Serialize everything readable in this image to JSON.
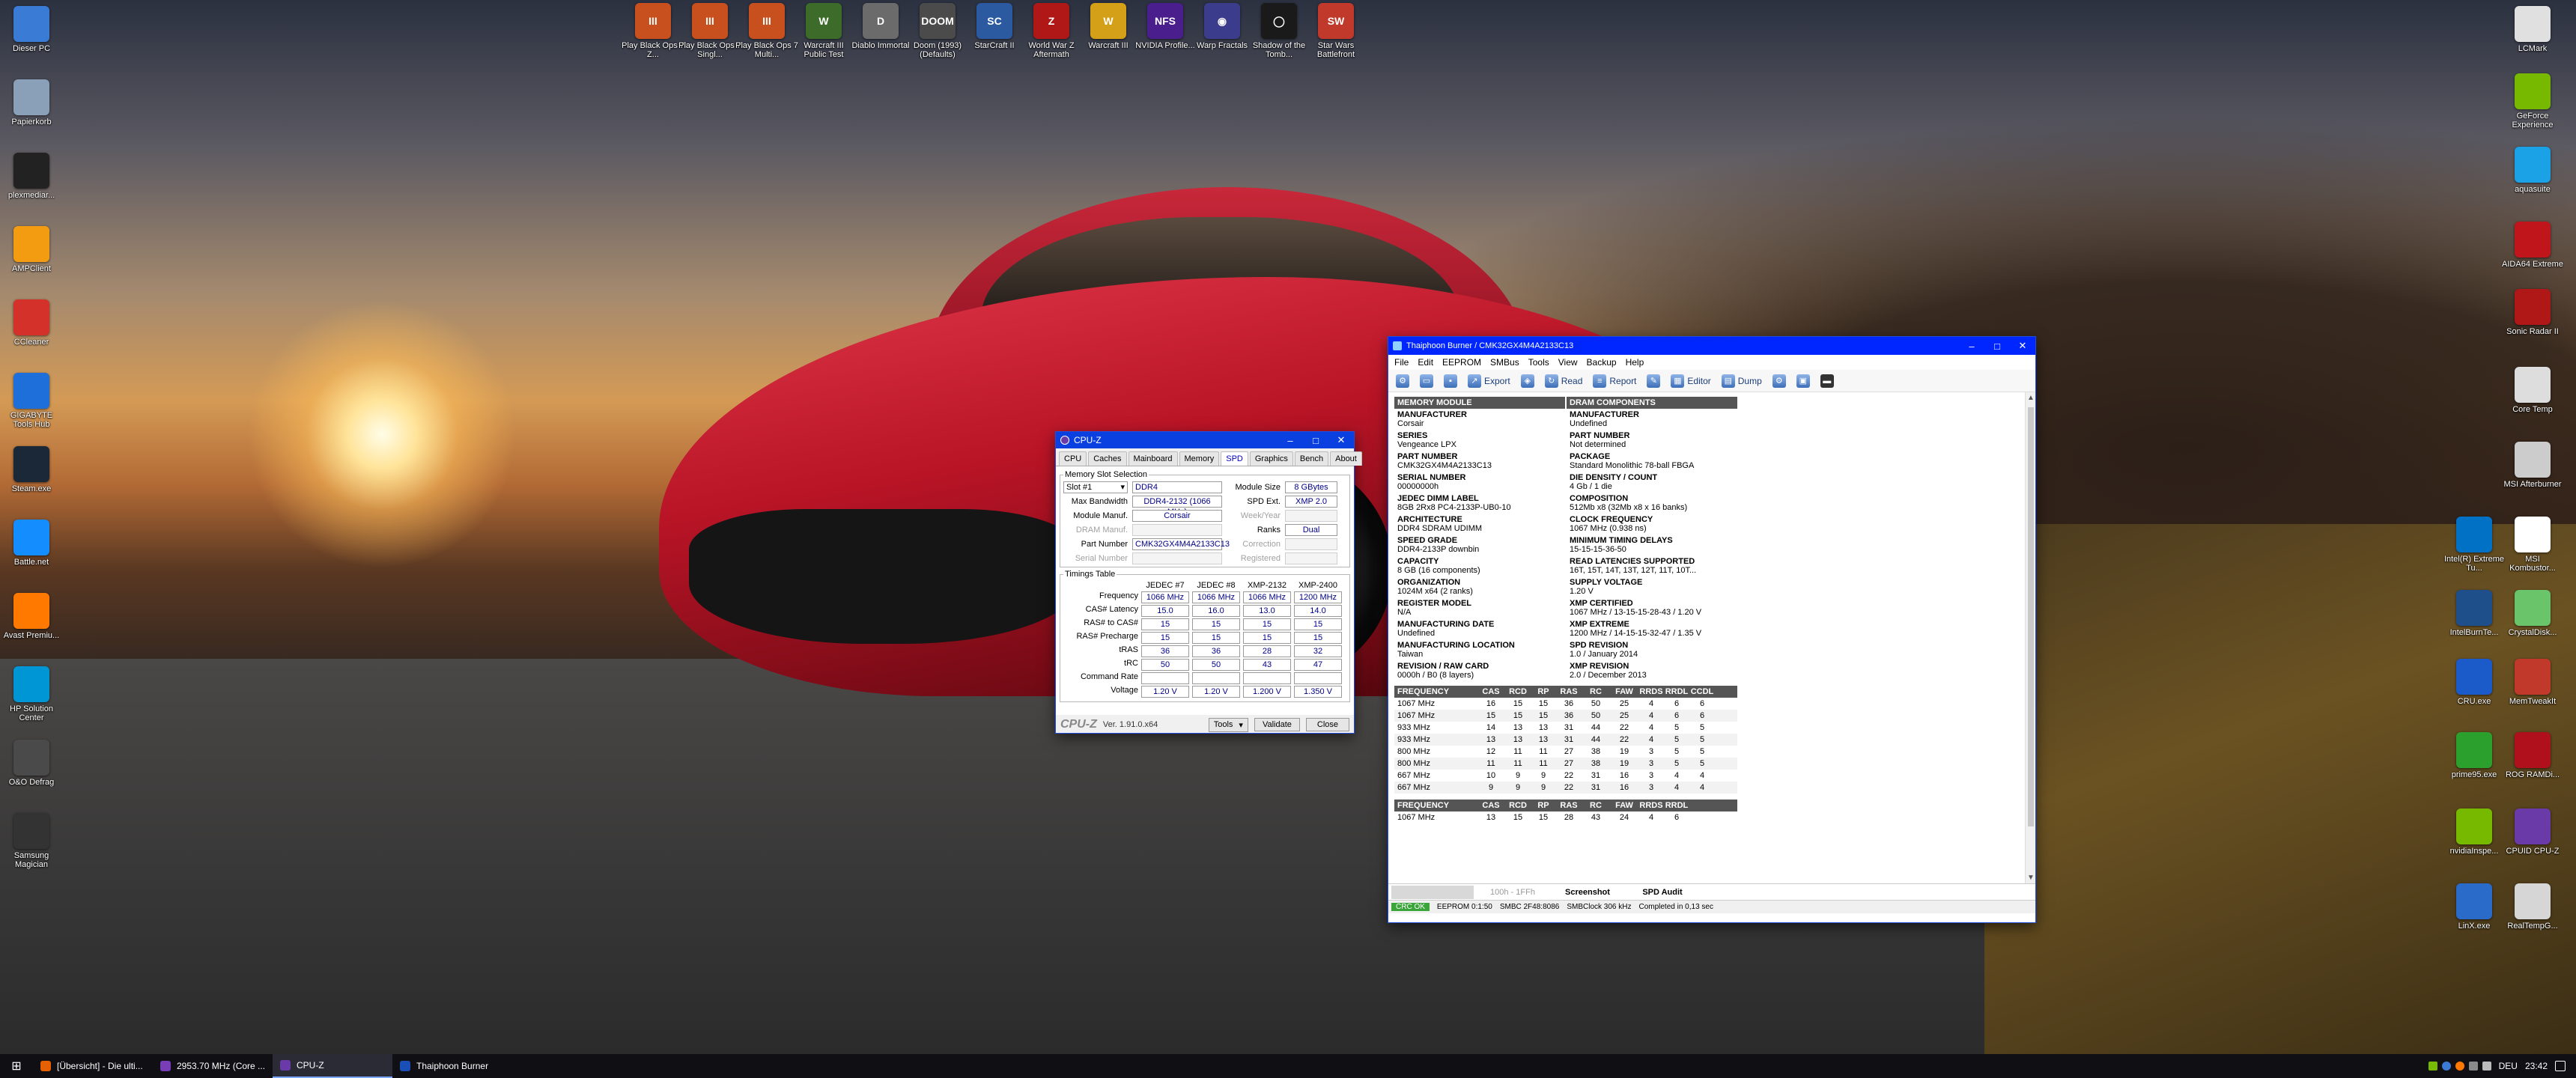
{
  "desktop": {
    "left_icons": [
      {
        "label": "Dieser PC",
        "icon": "pc-icon",
        "color": "#3a7bd5"
      },
      {
        "label": "Papierkorb",
        "icon": "recycle-bin-icon",
        "color": "#8aa0b8"
      },
      {
        "label": "plexmediar...",
        "icon": "penguin-icon",
        "color": "#222222"
      },
      {
        "label": "AMPClient",
        "icon": "amp-icon",
        "color": "#f39c12"
      },
      {
        "label": "CCleaner",
        "icon": "ccleaner-icon",
        "color": "#d4312b"
      },
      {
        "label": "GIGABYTE Tools Hub",
        "icon": "lightning-icon",
        "color": "#1e6fd9"
      },
      {
        "label": "Steam.exe",
        "icon": "steam-icon",
        "color": "#1b2838"
      },
      {
        "label": "Battle.net",
        "icon": "battlenet-icon",
        "color": "#148eff"
      },
      {
        "label": "Avast Premiu...",
        "icon": "avast-icon",
        "color": "#ff7800"
      },
      {
        "label": "HP Solution Center",
        "icon": "hp-icon",
        "color": "#0096d6"
      },
      {
        "label": "O&O Defrag",
        "icon": "defrag-icon",
        "color": "#4a4a4a"
      },
      {
        "label": "Samsung Magician",
        "icon": "samsung-icon",
        "color": "#333333"
      }
    ],
    "top_icons": [
      {
        "label": "Play Black Ops 7 Z...",
        "text": "III",
        "color": "#c8501e"
      },
      {
        "label": "Play Black Ops 7 Singl...",
        "text": "III",
        "color": "#c8501e"
      },
      {
        "label": "Play Black Ops 7 Multi...",
        "text": "III",
        "color": "#c8501e"
      },
      {
        "label": "Warcraft III Public Test",
        "text": "W",
        "color": "#3c6b2a"
      },
      {
        "label": "Diablo Immortal",
        "text": "D",
        "color": "#6b6b6b"
      },
      {
        "label": "Doom (1993) (Defaults)",
        "text": "DOOM",
        "color": "#4b4b4b"
      },
      {
        "label": "StarCraft II",
        "text": "SC",
        "color": "#2c5aa0"
      },
      {
        "label": "World War Z Aftermath",
        "text": "Z",
        "color": "#b01818"
      },
      {
        "label": "Warcraft III",
        "text": "W",
        "color": "#d4a017"
      },
      {
        "label": "NVIDIA Profile...",
        "text": "NFS",
        "color": "#4a1e8c"
      },
      {
        "label": "Warp Fractals",
        "text": "◉",
        "color": "#3c3c8c"
      },
      {
        "label": "Shadow of the Tomb...",
        "text": "◯",
        "color": "#1a1a1a"
      },
      {
        "label": "Star Wars Battlefront",
        "text": "SW",
        "color": "#c0392b"
      }
    ],
    "right_icons": [
      {
        "label": "LCMark",
        "icon": "document-icon",
        "color": "#e0e0e0"
      },
      {
        "label": "GeForce Experience",
        "icon": "nvidia-icon",
        "color": "#76b900"
      },
      {
        "label": "aquasuite",
        "icon": "aquasuite-icon",
        "color": "#1aa1e6"
      },
      {
        "label": "AIDA64 Extreme",
        "icon": "aida64-icon",
        "color": "#c0151a"
      },
      {
        "label": "Sonic Radar II",
        "icon": "radar-icon",
        "color": "#b01818"
      },
      {
        "label": "Core Temp",
        "icon": "thermometer-icon",
        "color": "#dddddd"
      },
      {
        "label": "MSI Afterburner",
        "icon": "afterburner-icon",
        "color": "#cccccc"
      },
      {
        "label": "Intel(R) Extreme Tu...",
        "icon": "intel-icon",
        "color": "#0071c5"
      },
      {
        "label": "MSI Kombustor...",
        "icon": "kombustor-icon",
        "color": "#ffffff"
      },
      {
        "label": "IntelBurnTe...",
        "icon": "burn-icon",
        "color": "#1e4f8a"
      },
      {
        "label": "CrystalDisk...",
        "icon": "crystaldisk-icon",
        "color": "#6ac46a"
      },
      {
        "label": "CRU.exe",
        "icon": "cru-icon",
        "color": "#1a5bc9"
      },
      {
        "label": "MemTweakIt",
        "icon": "memtweak-icon",
        "color": "#c0392b"
      },
      {
        "label": "prime95.exe",
        "icon": "prime95-icon",
        "color": "#2ca02c"
      },
      {
        "label": "ROG RAMDi...",
        "icon": "rog-icon",
        "color": "#b0101c"
      },
      {
        "label": "nvidiaInspe...",
        "icon": "nvidia-inspector-icon",
        "color": "#76b900"
      },
      {
        "label": "CPUID CPU-Z",
        "icon": "cpuz-icon",
        "color": "#6a3aa8"
      },
      {
        "label": "LinX.exe",
        "icon": "linx-icon",
        "color": "#2a6ac8"
      },
      {
        "label": "RealTempG...",
        "icon": "realtemp-icon",
        "color": "#d6d6d6"
      }
    ]
  },
  "cpuz": {
    "title": "CPU-Z",
    "tabs": [
      "CPU",
      "Caches",
      "Mainboard",
      "Memory",
      "SPD",
      "Graphics",
      "Bench",
      "About"
    ],
    "active_tab": "SPD",
    "slot_section": "Memory Slot Selection",
    "slot": "Slot #1",
    "type": "DDR4",
    "labels": {
      "max_bw": "Max Bandwidth",
      "module_manuf": "Module Manuf.",
      "dram_manuf": "DRAM Manuf.",
      "part_number": "Part Number",
      "serial_number": "Serial Number",
      "module_size": "Module Size",
      "spd_ext": "SPD Ext.",
      "week_year": "Week/Year",
      "ranks": "Ranks",
      "correction": "Correction",
      "registered": "Registered"
    },
    "max_bw": "DDR4-2132 (1066 MHz)",
    "module_manuf": "Corsair",
    "part_number": "CMK32GX4M4A2133C13",
    "module_size": "8 GBytes",
    "spd_ext": "XMP 2.0",
    "ranks": "Dual",
    "timings_title": "Timings Table",
    "timing_headers": [
      "JEDEC #7",
      "JEDEC #8",
      "XMP-2132",
      "XMP-2400"
    ],
    "timing_rows": [
      {
        "label": "Frequency",
        "values": [
          "1066 MHz",
          "1066 MHz",
          "1066 MHz",
          "1200 MHz"
        ]
      },
      {
        "label": "CAS# Latency",
        "values": [
          "15.0",
          "16.0",
          "13.0",
          "14.0"
        ]
      },
      {
        "label": "RAS# to CAS#",
        "values": [
          "15",
          "15",
          "15",
          "15"
        ]
      },
      {
        "label": "RAS# Precharge",
        "values": [
          "15",
          "15",
          "15",
          "15"
        ]
      },
      {
        "label": "tRAS",
        "values": [
          "36",
          "36",
          "28",
          "32"
        ]
      },
      {
        "label": "tRC",
        "values": [
          "50",
          "50",
          "43",
          "47"
        ]
      },
      {
        "label": "Command Rate",
        "values": [
          "",
          "",
          "",
          ""
        ]
      },
      {
        "label": "Voltage",
        "values": [
          "1.20 V",
          "1.20 V",
          "1.200 V",
          "1.350 V"
        ]
      }
    ],
    "brand": "CPU-Z",
    "version": "Ver. 1.91.0.x64",
    "tools_label": "Tools",
    "validate_label": "Validate",
    "close_label": "Close"
  },
  "thaiphoon": {
    "title": "Thaiphoon Burner / CMK32GX4M4A2133C13",
    "menu": [
      "File",
      "Edit",
      "EEPROM",
      "SMBus",
      "Tools",
      "View",
      "Backup",
      "Help"
    ],
    "tools": {
      "export": "Export",
      "read": "Read",
      "report": "Report",
      "editor": "Editor",
      "dump": "Dump"
    },
    "col_left_header": "MEMORY MODULE",
    "col_right_header": "DRAM COMPONENTS",
    "left_fields": [
      {
        "k": "MANUFACTURER",
        "v": "Corsair"
      },
      {
        "k": "SERIES",
        "v": "Vengeance LPX"
      },
      {
        "k": "PART NUMBER",
        "v": "CMK32GX4M4A2133C13"
      },
      {
        "k": "SERIAL NUMBER",
        "v": "00000000h"
      },
      {
        "k": "JEDEC DIMM LABEL",
        "v": "8GB 2Rx8 PC4-2133P-UB0-10"
      },
      {
        "k": "ARCHITECTURE",
        "v": "DDR4 SDRAM UDIMM"
      },
      {
        "k": "SPEED GRADE",
        "v": "DDR4-2133P downbin"
      },
      {
        "k": "CAPACITY",
        "v": "8 GB (16 components)"
      },
      {
        "k": "ORGANIZATION",
        "v": "1024M x64 (2 ranks)"
      },
      {
        "k": "REGISTER MODEL",
        "v": "N/A"
      },
      {
        "k": "MANUFACTURING DATE",
        "v": "Undefined"
      },
      {
        "k": "MANUFACTURING LOCATION",
        "v": "Taiwan"
      },
      {
        "k": "REVISION / RAW CARD",
        "v": "0000h / B0 (8 layers)"
      }
    ],
    "right_fields": [
      {
        "k": "MANUFACTURER",
        "v": "Undefined"
      },
      {
        "k": "PART NUMBER",
        "v": "Not determined"
      },
      {
        "k": "PACKAGE",
        "v": "Standard Monolithic 78-ball FBGA"
      },
      {
        "k": "DIE DENSITY / COUNT",
        "v": "4 Gb / 1 die"
      },
      {
        "k": "COMPOSITION",
        "v": "512Mb x8 (32Mb x8 x 16 banks)"
      },
      {
        "k": "CLOCK FREQUENCY",
        "v": "1067 MHz (0.938 ns)"
      },
      {
        "k": "MINIMUM TIMING DELAYS",
        "v": "15-15-15-36-50"
      },
      {
        "k": "READ LATENCIES SUPPORTED",
        "v": "16T, 15T, 14T, 13T, 12T, 11T, 10T..."
      },
      {
        "k": "SUPPLY VOLTAGE",
        "v": "1.20 V"
      },
      {
        "k": "XMP CERTIFIED",
        "v": "1067 MHz / 13-15-15-28-43 / 1.20 V"
      },
      {
        "k": "XMP EXTREME",
        "v": "1200 MHz / 14-15-15-32-47 / 1.35 V"
      },
      {
        "k": "SPD REVISION",
        "v": "1.0 / January 2014"
      },
      {
        "k": "XMP REVISION",
        "v": "2.0 / December 2013"
      }
    ],
    "freq_headers": [
      "FREQUENCY",
      "CAS",
      "RCD",
      "RP",
      "RAS",
      "RC",
      "FAW",
      "RRDS",
      "RRDL",
      "CCDL"
    ],
    "freq_rows": [
      [
        "1067 MHz",
        "16",
        "15",
        "15",
        "36",
        "50",
        "25",
        "4",
        "6",
        "6"
      ],
      [
        "1067 MHz",
        "15",
        "15",
        "15",
        "36",
        "50",
        "25",
        "4",
        "6",
        "6"
      ],
      [
        "933 MHz",
        "14",
        "13",
        "13",
        "31",
        "44",
        "22",
        "4",
        "5",
        "5"
      ],
      [
        "933 MHz",
        "13",
        "13",
        "13",
        "31",
        "44",
        "22",
        "4",
        "5",
        "5"
      ],
      [
        "800 MHz",
        "12",
        "11",
        "11",
        "27",
        "38",
        "19",
        "3",
        "5",
        "5"
      ],
      [
        "800 MHz",
        "11",
        "11",
        "11",
        "27",
        "38",
        "19",
        "3",
        "5",
        "5"
      ],
      [
        "667 MHz",
        "10",
        "9",
        "9",
        "22",
        "31",
        "16",
        "3",
        "4",
        "4"
      ],
      [
        "667 MHz",
        "9",
        "9",
        "9",
        "22",
        "31",
        "16",
        "3",
        "4",
        "4"
      ]
    ],
    "xmp_headers": [
      "FREQUENCY",
      "CAS",
      "RCD",
      "RP",
      "RAS",
      "RC",
      "FAW",
      "RRDS",
      "RRDL"
    ],
    "xmp_rows": [
      [
        "1067 MHz",
        "13",
        "15",
        "15",
        "28",
        "43",
        "24",
        "4",
        "6"
      ]
    ],
    "bottom_tabs": [
      "100h - 1FFh",
      "Screenshot",
      "SPD Audit"
    ],
    "status": {
      "crc": "CRC OK",
      "eeprom": "EEPROM 0:1:50",
      "smbc": "SMBC 2F48:8086",
      "clock": "SMBClock 306 kHz",
      "done": "Completed in 0,13 sec"
    }
  },
  "taskbar": {
    "tasks": [
      {
        "label": "[Übersicht] - Die ulti...",
        "color": "#e66000"
      },
      {
        "label": "2953.70 MHz (Core ...",
        "color": "#7a3db8"
      },
      {
        "label": "CPU-Z",
        "color": "#6a3aa8"
      },
      {
        "label": "Thaiphoon Burner",
        "color": "#1a4fb8"
      }
    ],
    "lang": "DEU",
    "time": "23:42"
  }
}
